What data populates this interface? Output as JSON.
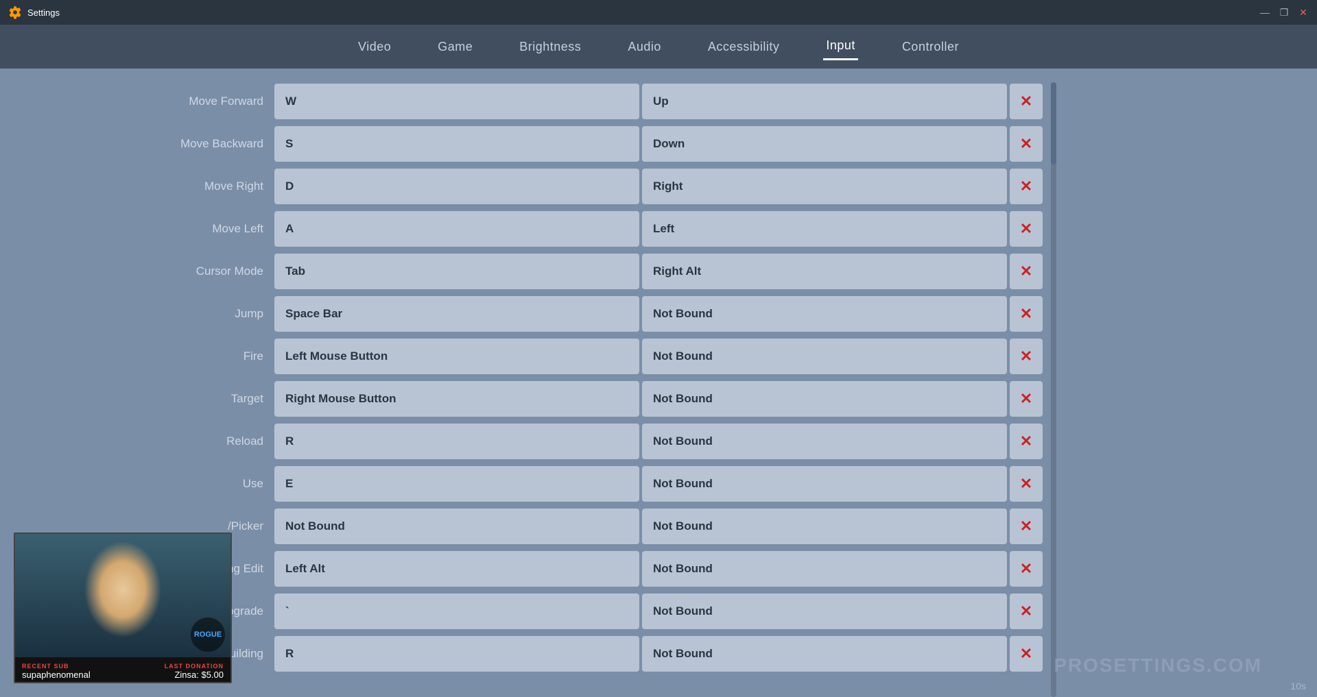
{
  "titlebar": {
    "title": "Settings",
    "controls": {
      "minimize": "—",
      "restore": "❐",
      "close": "✕"
    }
  },
  "nav": {
    "items": [
      {
        "id": "video",
        "label": "Video",
        "active": false
      },
      {
        "id": "game",
        "label": "Game",
        "active": false
      },
      {
        "id": "brightness",
        "label": "Brightness",
        "active": false
      },
      {
        "id": "audio",
        "label": "Audio",
        "active": false
      },
      {
        "id": "accessibility",
        "label": "Accessibility",
        "active": false
      },
      {
        "id": "input",
        "label": "Input",
        "active": true
      },
      {
        "id": "controller",
        "label": "Controller",
        "active": false
      }
    ]
  },
  "bindings": [
    {
      "action": "Move Forward",
      "primary": "W",
      "secondary": "Up"
    },
    {
      "action": "Move Backward",
      "primary": "S",
      "secondary": "Down"
    },
    {
      "action": "Move Right",
      "primary": "D",
      "secondary": "Right"
    },
    {
      "action": "Move Left",
      "primary": "A",
      "secondary": "Left"
    },
    {
      "action": "Cursor Mode",
      "primary": "Tab",
      "secondary": "Right Alt"
    },
    {
      "action": "Jump",
      "primary": "Space Bar",
      "secondary": "Not Bound"
    },
    {
      "action": "Fire",
      "primary": "Left Mouse Button",
      "secondary": "Not Bound"
    },
    {
      "action": "Target",
      "primary": "Right Mouse Button",
      "secondary": "Not Bound"
    },
    {
      "action": "Reload",
      "primary": "R",
      "secondary": "Not Bound"
    },
    {
      "action": "Use",
      "primary": "E",
      "secondary": "Not Bound"
    },
    {
      "action": "/Picker",
      "primary": "Not Bound",
      "secondary": "Not Bound"
    },
    {
      "action": "Building Edit",
      "primary": "Left Alt",
      "secondary": "Not Bound"
    },
    {
      "action": "Repair/Upgrade",
      "primary": "`",
      "secondary": "Not Bound"
    },
    {
      "action": "Rotate Building",
      "primary": "R",
      "secondary": "Not Bound"
    }
  ],
  "webcam": {
    "recent_sub_label": "RECENT SUB",
    "recent_sub_value": "supaphenomenal",
    "last_donation_label": "LAST DONATION",
    "last_donation_value": "Zinsa: $5.00"
  },
  "watermark": "PROSETTINGS.COM",
  "timer": "10s",
  "clear_icon": "✕"
}
